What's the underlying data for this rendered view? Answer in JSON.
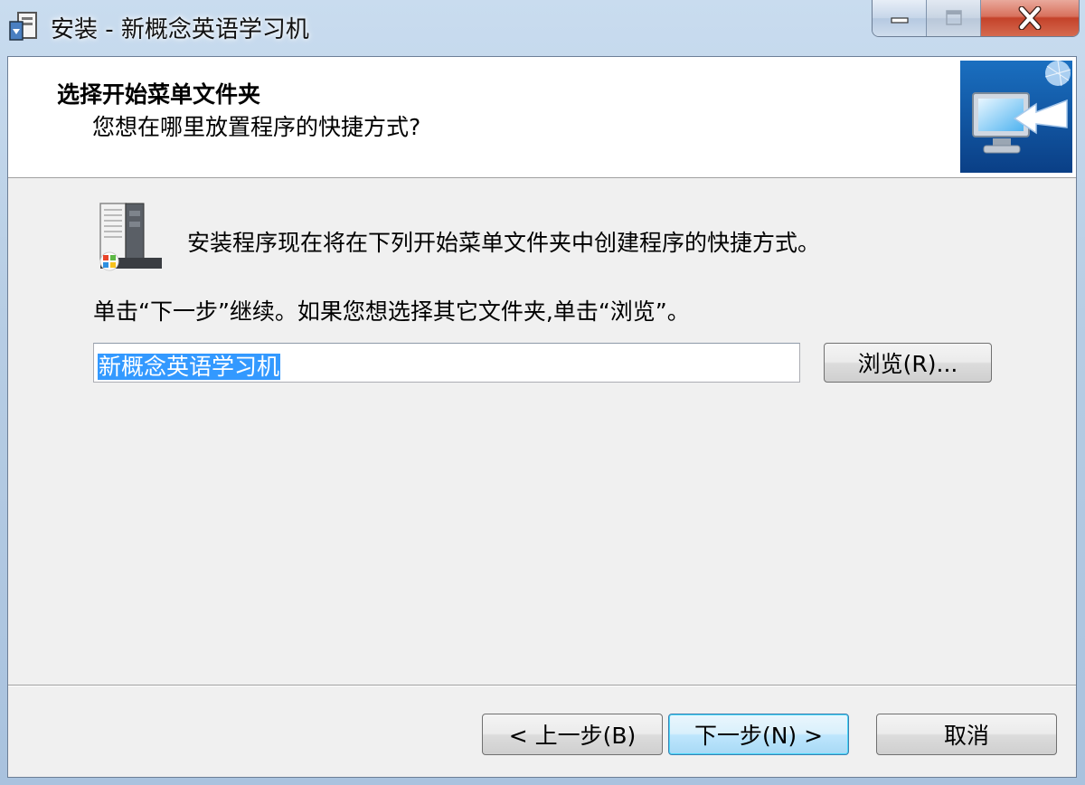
{
  "window": {
    "title": "安装 - 新概念英语学习机"
  },
  "header": {
    "title": "选择开始菜单文件夹",
    "subtitle": "您想在哪里放置程序的快捷方式?"
  },
  "main": {
    "info_text": "安装程序现在将在下列开始菜单文件夹中创建程序的快捷方式。",
    "instruction_text": "单击“下一步”继续。如果您想选择其它文件夹,单击“浏览”。",
    "folder_value": "新概念英语学习机",
    "browse_label": "浏览(R)..."
  },
  "footer": {
    "back_label": "< 上一步(B)",
    "next_label": "下一步(N) >",
    "cancel_label": "取消"
  },
  "icons": {
    "app": "installer-icon",
    "header_image": "monitor-arrow-icon",
    "section": "start-menu-folder-icon"
  },
  "colors": {
    "selection": "#3399ff",
    "close_button": "#c4422a",
    "client_bg": "#f0f0f0"
  }
}
